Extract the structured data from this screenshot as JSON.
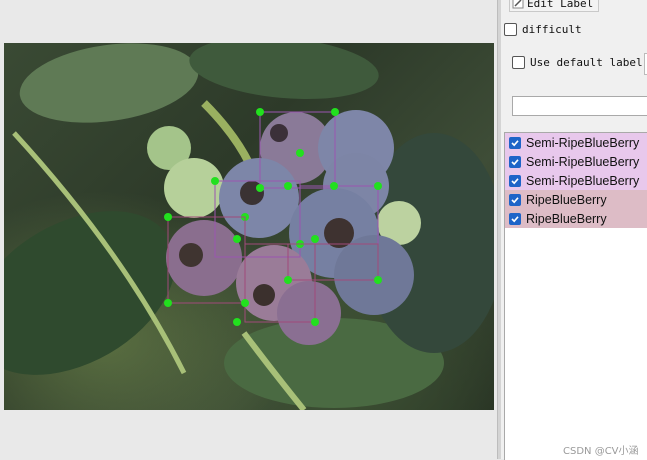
{
  "sidebar": {
    "edit_label_button": "Edit Label",
    "difficult_label": "difficult",
    "use_default_label": "Use default label",
    "label_input_value": "",
    "labels": [
      {
        "text": "Semi-RipeBlueBerry",
        "checked": true,
        "color": "#e8c8ec"
      },
      {
        "text": "Semi-RipeBlueBerry",
        "checked": true,
        "color": "#e8c8ec"
      },
      {
        "text": "Semi-RipeBlueBerry",
        "checked": true,
        "color": "#e8c8ec"
      },
      {
        "text": "RipeBlueBerry",
        "checked": true,
        "color": "#ddbcc6"
      },
      {
        "text": "RipeBlueBerry",
        "checked": true,
        "color": "#ddbcc6"
      }
    ]
  },
  "watermark": "CSDN @CV小涵",
  "colors": {
    "vertex": "#22e01e",
    "box_ripe": "#a04a7a",
    "box_semi": "#9a55b0",
    "checkbox_accent": "#1e64c8"
  }
}
